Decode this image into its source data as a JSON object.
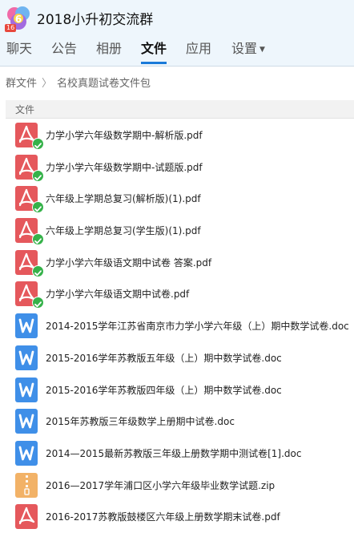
{
  "group": {
    "title": "2018小升初交流群",
    "avatar_tag": "16"
  },
  "tabs": [
    {
      "label": "聊天"
    },
    {
      "label": "公告"
    },
    {
      "label": "相册"
    },
    {
      "label": "文件",
      "active": true
    },
    {
      "label": "应用"
    },
    {
      "label": "设置"
    }
  ],
  "breadcrumb": {
    "root": "群文件",
    "separator": "〉",
    "current": "名校真题试卷文件包"
  },
  "list_header": {
    "column_label": "文件"
  },
  "colors": {
    "pdf": "#e5585c",
    "doc": "#3f8fe8",
    "zip": "#f2b267",
    "active_tab": "#1a7ad9",
    "check": "#36b24a"
  },
  "files": [
    {
      "name": "力学小学六年级数学期中-解析版.pdf",
      "type": "pdf",
      "icon": "pdf-icon",
      "downloaded": true
    },
    {
      "name": "力学小学六年级数学期中-试题版.pdf",
      "type": "pdf",
      "icon": "pdf-icon",
      "downloaded": true
    },
    {
      "name": "六年级上学期总复习(解析版)(1).pdf",
      "type": "pdf",
      "icon": "pdf-icon",
      "downloaded": true
    },
    {
      "name": "六年级上学期总复习(学生版)(1).pdf",
      "type": "pdf",
      "icon": "pdf-icon",
      "downloaded": true
    },
    {
      "name": "力学小学六年级语文期中试卷 答案.pdf",
      "type": "pdf",
      "icon": "pdf-icon",
      "downloaded": true
    },
    {
      "name": "力学小学六年级语文期中试卷.pdf",
      "type": "pdf",
      "icon": "pdf-icon",
      "downloaded": true
    },
    {
      "name": "2014-2015学年江苏省南京市力学小学六年级（上）期中数学试卷.doc",
      "type": "doc",
      "icon": "word-icon",
      "downloaded": false
    },
    {
      "name": "2015-2016学年苏教版五年级（上）期中数学试卷.doc",
      "type": "doc",
      "icon": "word-icon",
      "downloaded": false
    },
    {
      "name": "2015-2016学年苏教版四年级（上）期中数学试卷.doc",
      "type": "doc",
      "icon": "word-icon",
      "downloaded": false
    },
    {
      "name": "2015年苏教版三年级数学上册期中试卷.doc",
      "type": "doc",
      "icon": "word-icon",
      "downloaded": false
    },
    {
      "name": "2014—2015最新苏教版三年级上册数学期中测试卷[1].doc",
      "type": "doc",
      "icon": "word-icon",
      "downloaded": false
    },
    {
      "name": "2016—2017学年浦口区小学六年级毕业数学试题.zip",
      "type": "zip",
      "icon": "zip-icon",
      "downloaded": false
    },
    {
      "name": "2016-2017苏教版鼓楼区六年级上册数学期末试卷.pdf",
      "type": "pdf",
      "icon": "pdf-icon",
      "downloaded": false
    }
  ]
}
